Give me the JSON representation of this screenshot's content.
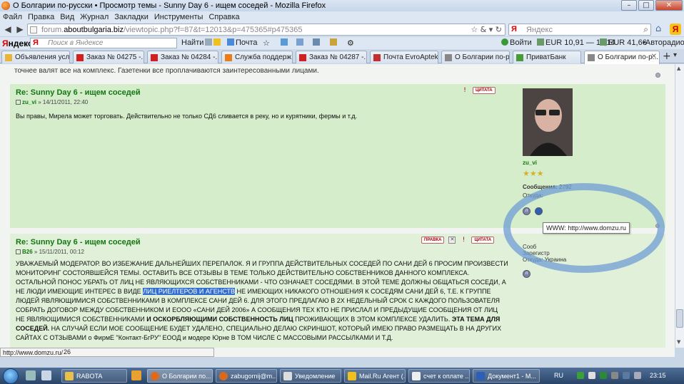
{
  "window": {
    "title": "О Болгарии по-русски • Просмотр темы - Sunny Day 6 - ищем соседей - Mozilla Firefox",
    "min": "–",
    "max": "□",
    "close": "✕"
  },
  "menu": [
    "Файл",
    "Правка",
    "Вид",
    "Журнал",
    "Закладки",
    "Инструменты",
    "Справка"
  ],
  "nav": {
    "back": "◀",
    "forward": "▶",
    "url_domain_prefix": "forum.",
    "url_domain": "aboutbulgaria.biz",
    "url_path": "/viewtopic.php?f=87&t=12013&p=475365#p475365",
    "url_buttons": "☆ & ▾ ↻",
    "search_engine": "Я",
    "search_placeholder": "Яндекс"
  },
  "yandex_bar": {
    "logo_prefix": "Я",
    "logo_rest": "ндекс",
    "search_placeholder": "Поиск в Яндексе",
    "find_label": "Найти",
    "mail_label": "Почта",
    "signin_label": "Войти",
    "eur_rate": "EUR 10,91 — 11,14",
    "eur_rate2": "EUR 41,66",
    "autoradio": "Авторадио"
  },
  "tabs": [
    {
      "label": "Объявления усл...",
      "color": "#e8b43a"
    },
    {
      "label": "Заказ № 04275 -...",
      "color": "#d02020"
    },
    {
      "label": "Заказ № 04284 -...",
      "color": "#d02020"
    },
    {
      "label": "Служба поддерж...",
      "color": "#e87d1a"
    },
    {
      "label": "Заказ № 04287 -...",
      "color": "#d02020"
    },
    {
      "label": "Почта EvroAptek...",
      "color": "#c03030"
    },
    {
      "label": "О Болгарии по-р...",
      "color": "#888888"
    },
    {
      "label": "ПриватБанк",
      "color": "#4a9a3a"
    },
    {
      "label": "О Болгарии по-р...",
      "color": "#888888",
      "close": "✕"
    }
  ],
  "prev_text": "точнее валят все на комплекс. Газетенки все проплачиваются заинтересованными лицами.",
  "post1": {
    "subject": "Re: Sunny Day 6 - ищем соседей",
    "author": "zu_vi",
    "date": " » 14/11/2011, 22:40",
    "quote_label": "ЦИТАТА",
    "body": "Вы правы, Мирела может торговать. Действительно не только СД6 сливается в реку, но и курятники, фермы и т.д.",
    "profile": {
      "username": "zu_vi",
      "stars": "★★★",
      "posts_label": "Сообщения:",
      "posts_value": "2792",
      "from_label": "Откуда:"
    }
  },
  "tooltip": "WWW: http://www.domzu.ru",
  "post2": {
    "subject": "Re: Sunny Day 6 - ищем соседей",
    "author": "B26",
    "date": " » 15/11/2011, 00:12",
    "edit_label": "ПРАВКА",
    "delete_label": "✕",
    "quote_label": "ЦИТАТА",
    "body_part1": "УВАЖАЕМЫЙ МОДЕРАТОР. ВО ИЗБЕЖАНИЕ ДАЛЬНЕЙШИХ ПЕРЕПАЛОК. Я И ГРУППА ДЕЙСТВИТЕЛЬНЫХ СОСЕДЕЙ ПО САНИ ДЕЙ 6 ПРОСИМ ПРОИЗВЕСТИ МОНИТОРИНГ СОСТОЯВШЕЙСЯ ТЕМЫ. ОСТАВИТЬ ВСЕ ОТЗЫВЫ В ТЕМЕ ТОЛЬКО ДЕЙСТВИТЕЛЬНО СОБСТВЕННИКОВ ДАННОГО КОМПЛЕКСА. ОСТАЛЬНОЙ ПОНОС УБРАТЬ ОТ ЛИЦ НЕ ЯВЛЯЮЩИХСЯ СОБСТВЕННИКАМИ - ЧТО ОЗНАЧАЕТ СОСЕДЯМИ. В ЭТОЙ ТЕМЕ ДОЛЖНЫ ОБЩАТЬСЯ СОСЕДИ, А НЕ ЛЮДИ ИМЕЮЩИЕ ИНТЕРЕС В ВИДЕ ",
    "body_highlight": "ЛИЦ РИЕЛТЕРОВ И АГЕНСТВ",
    "body_part2": " НЕ ИМЕЮЩИХ НИКАКОГО ОТНОШЕНИЯ К СОСЕДЯМ САНИ ДЕЙ 6, Т.Е. К ГРУППЕ ЛЮДЕЙ ЯВЛЯЮЩИМИСЯ СОБСТВЕННИКАМИ В КОМПЛЕКСЕ САНИ ДЕЙ 6. ДЛЯ ЭТОГО ПРЕДЛАГАЮ В 2Х НЕДЕЛЬНЫЙ СРОК С КАЖДОГО ПОЛЬЗОВАТЕЛЯ СОБРАТЬ ДОГОВОР МЕЖДУ СОБСТВЕННИКОМ И ЕООО «САНИ ДЕЙ 2006» А СООБЩЕНИЯ ТЕХ КТО НЕ ПРИСЛАЛ И ПРЕДЫДУЩИЕ СООБЩЕНИЯ ОТ ЛИЦ НЕ ЯВЛЯЮЩИМИСЯ СОБСТВЕННИКАМИ ",
    "body_bold1": "И ОСКОРБЛЯЮЩИМИ СОБСТВЕННОСТЬ ЛИЦ",
    "body_part3": " ПРОЖИВАЮЩИХ В ЭТОМ КОМПЛЕКСЕ УДАЛИТЬ. ",
    "body_bold2": "ЭТА ТЕМА ДЛЯ СОСЕДЕЙ.",
    "body_part4": " НА СЛУЧАЙ ЕСЛИ МОЕ СООБЩЕНИЕ БУДЕТ УДАЛЕНО, СПЕЦИАЛЬНО ДЕЛАЮ СКРИНШОТ, КОТОРЫЙ ИМЕЮ ПРАВО РАЗМЕЩАТЬ В НА ДРУГИХ САЙТАХ С ОТЗЫВАМИ о ФирмЕ \"Контакт-БгРУ\" ЕООД и модере Юрне В ТОМ ЧИСЛЕ С МАССОВЫМИ РАССЫЛКАМИ И Т.Д.",
    "trailing": "26",
    "profile": {
      "line1": "Сооб",
      "line2": "Зарегистр",
      "from_label": "Откуда:",
      "from_value": "Украина"
    }
  },
  "status_text": "http://www.domzu.ru/",
  "taskbar": {
    "items": [
      {
        "label": "RABOTA",
        "color": "#e8c04a"
      },
      {
        "label": "О Болгарии по...",
        "color": "#e06a1a",
        "active": true
      },
      {
        "label": "zabugornij@m...",
        "color": "#d86a20"
      },
      {
        "label": "Уведомление",
        "color": "#dddddd"
      },
      {
        "label": "Mail.Ru Агент (...",
        "color": "#f0c020"
      },
      {
        "label": "счет к оплате ...",
        "color": "#eeeeee"
      },
      {
        "label": "Документ1 - М...",
        "color": "#2b5fb8"
      }
    ],
    "lang": "RU",
    "time": "23:15"
  }
}
